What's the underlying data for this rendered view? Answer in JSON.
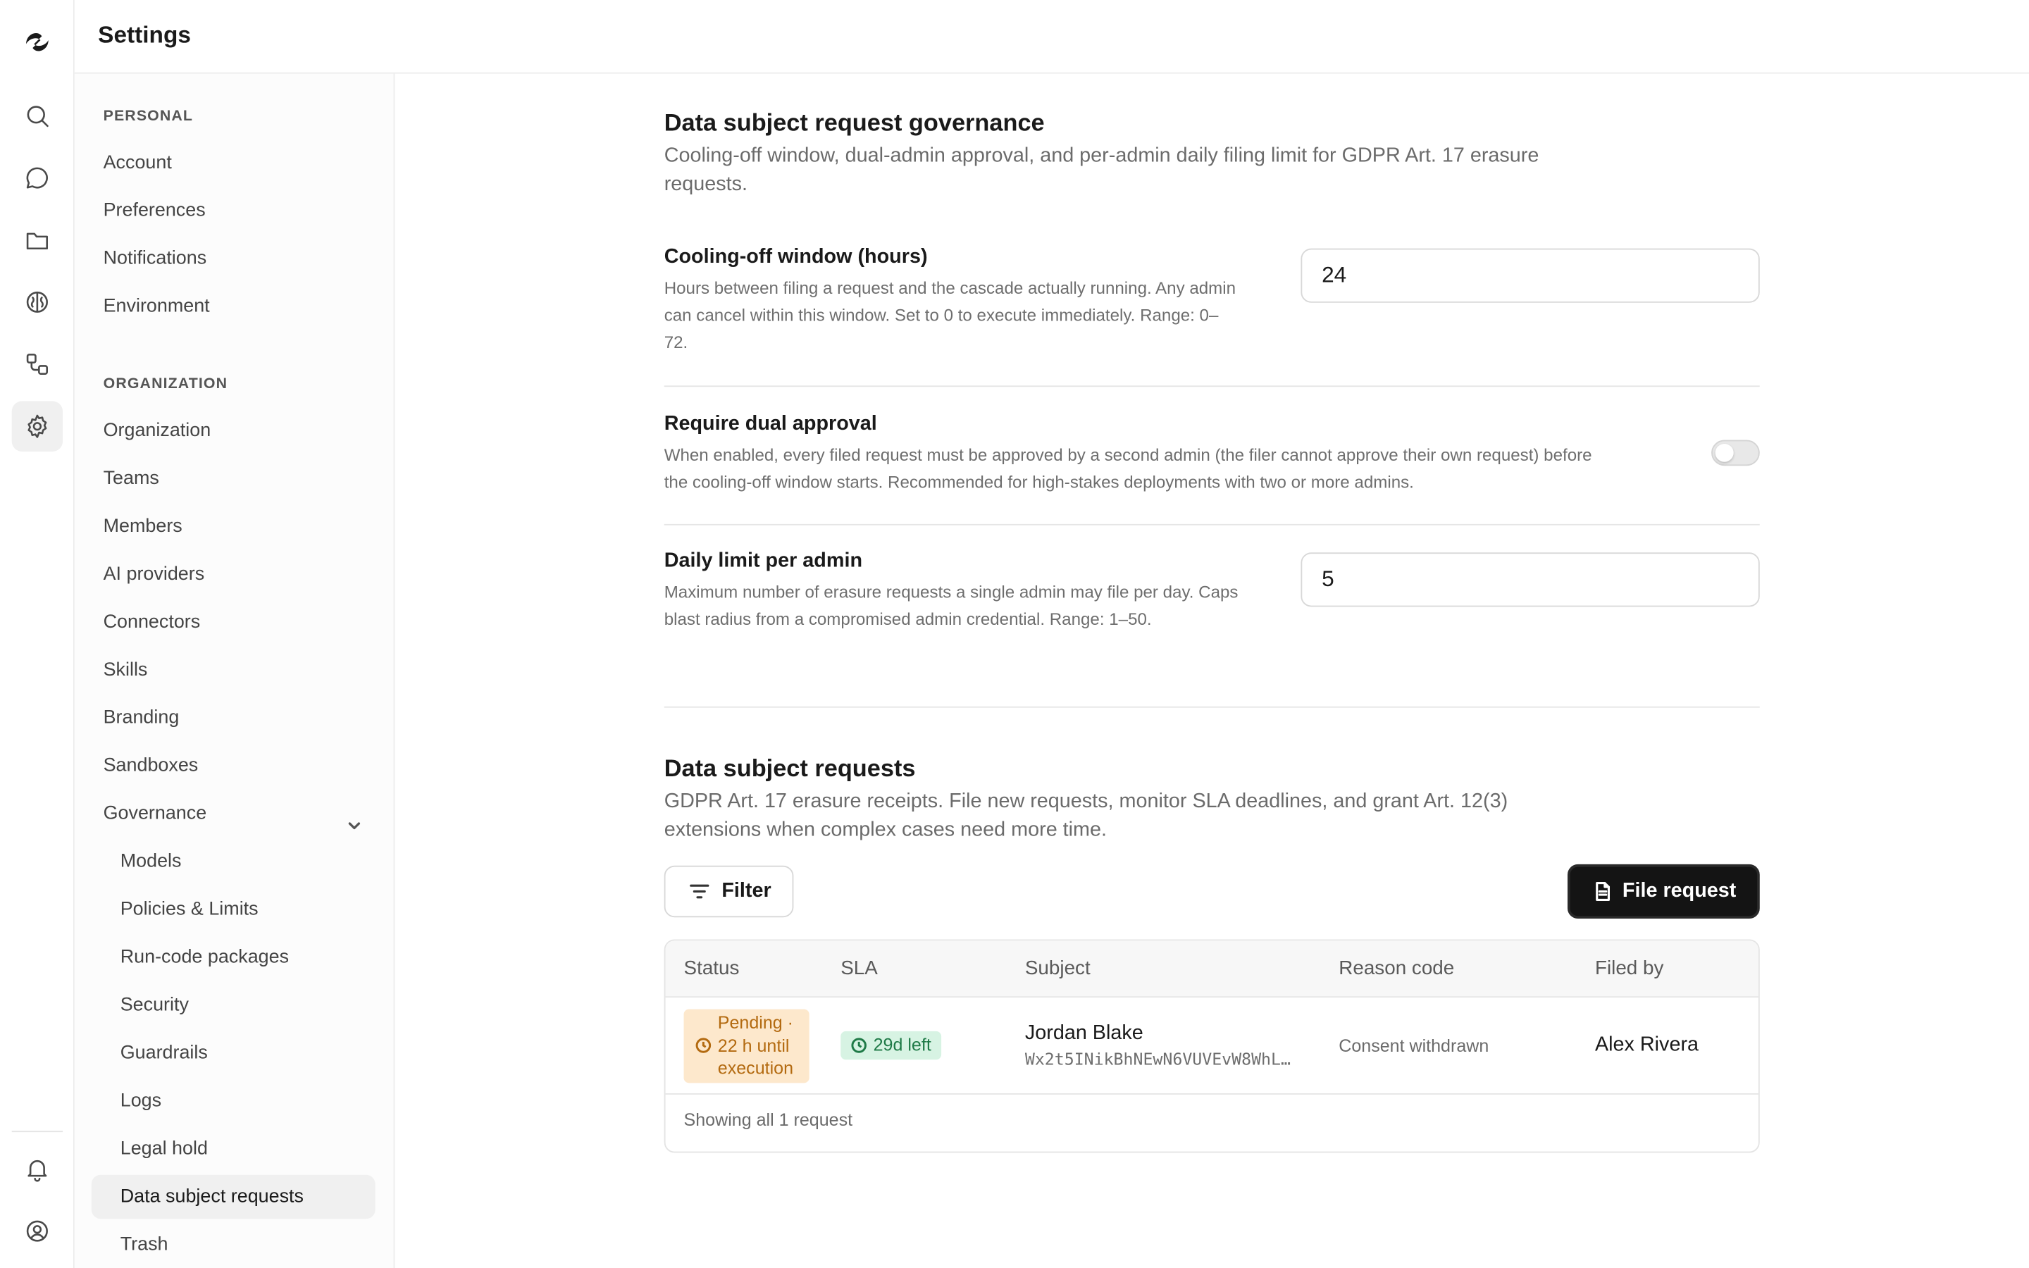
{
  "header": {
    "title": "Settings"
  },
  "rail": {
    "icons": [
      "logo-icon",
      "search-icon",
      "chat-icon",
      "folder-icon",
      "brain-icon",
      "workflow-icon",
      "gear-icon",
      "bell-icon",
      "user-circle-icon"
    ]
  },
  "sidebar": {
    "personal_heading": "PERSONAL",
    "personal_items": [
      "Account",
      "Preferences",
      "Notifications",
      "Environment"
    ],
    "org_heading": "ORGANIZATION",
    "org_items": [
      "Organization",
      "Teams",
      "Members",
      "AI providers",
      "Connectors",
      "Skills",
      "Branding",
      "Sandboxes",
      "Governance"
    ],
    "governance_items": [
      "Models",
      "Policies & Limits",
      "Run-code packages",
      "Security",
      "Guardrails",
      "Logs",
      "Legal hold",
      "Data subject requests",
      "Trash"
    ],
    "active_item": "Data subject requests"
  },
  "governance": {
    "title": "Data subject request governance",
    "description": "Cooling-off window, dual-admin approval, and per-admin daily filing limit for GDPR Art. 17 erasure requests.",
    "cooling": {
      "label": "Cooling-off window (hours)",
      "help": "Hours between filing a request and the cascade actually running. Any admin can cancel within this window. Set to 0 to execute immediately. Range: 0–72.",
      "value": "24"
    },
    "dual": {
      "label": "Require dual approval",
      "help": "When enabled, every filed request must be approved by a second admin (the filer cannot approve their own request) before the cooling-off window starts. Recommended for high-stakes deployments with two or more admins.",
      "enabled": false
    },
    "limit": {
      "label": "Daily limit per admin",
      "help": "Maximum number of erasure requests a single admin may file per day. Caps blast radius from a compromised admin credential. Range: 1–50.",
      "value": "5"
    }
  },
  "requests": {
    "title": "Data subject requests",
    "description": "GDPR Art. 17 erasure receipts. File new requests, monitor SLA deadlines, and grant Art. 12(3) extensions when complex cases need more time.",
    "filter_label": "Filter",
    "file_label": "File request",
    "columns": [
      "Status",
      "SLA",
      "Subject",
      "Reason code",
      "Filed by"
    ],
    "rows": [
      {
        "status_l1": "Pending ·",
        "status_l2": "22 h until",
        "status_l3": "execution",
        "sla": "29d left",
        "subject_name": "Jordan Blake",
        "subject_id": "Wx2t5INikBhNEwN6VUVEvW8WhL…",
        "reason": "Consent withdrawn",
        "filed_by": "Alex Rivera"
      }
    ],
    "footer": "Showing all 1 request"
  },
  "colors": {
    "pending_bg": "#fde8cc",
    "pending_fg": "#b36a10",
    "sla_bg": "#d7f3e3",
    "sla_fg": "#1f7a47",
    "primary_button": "#141414"
  }
}
